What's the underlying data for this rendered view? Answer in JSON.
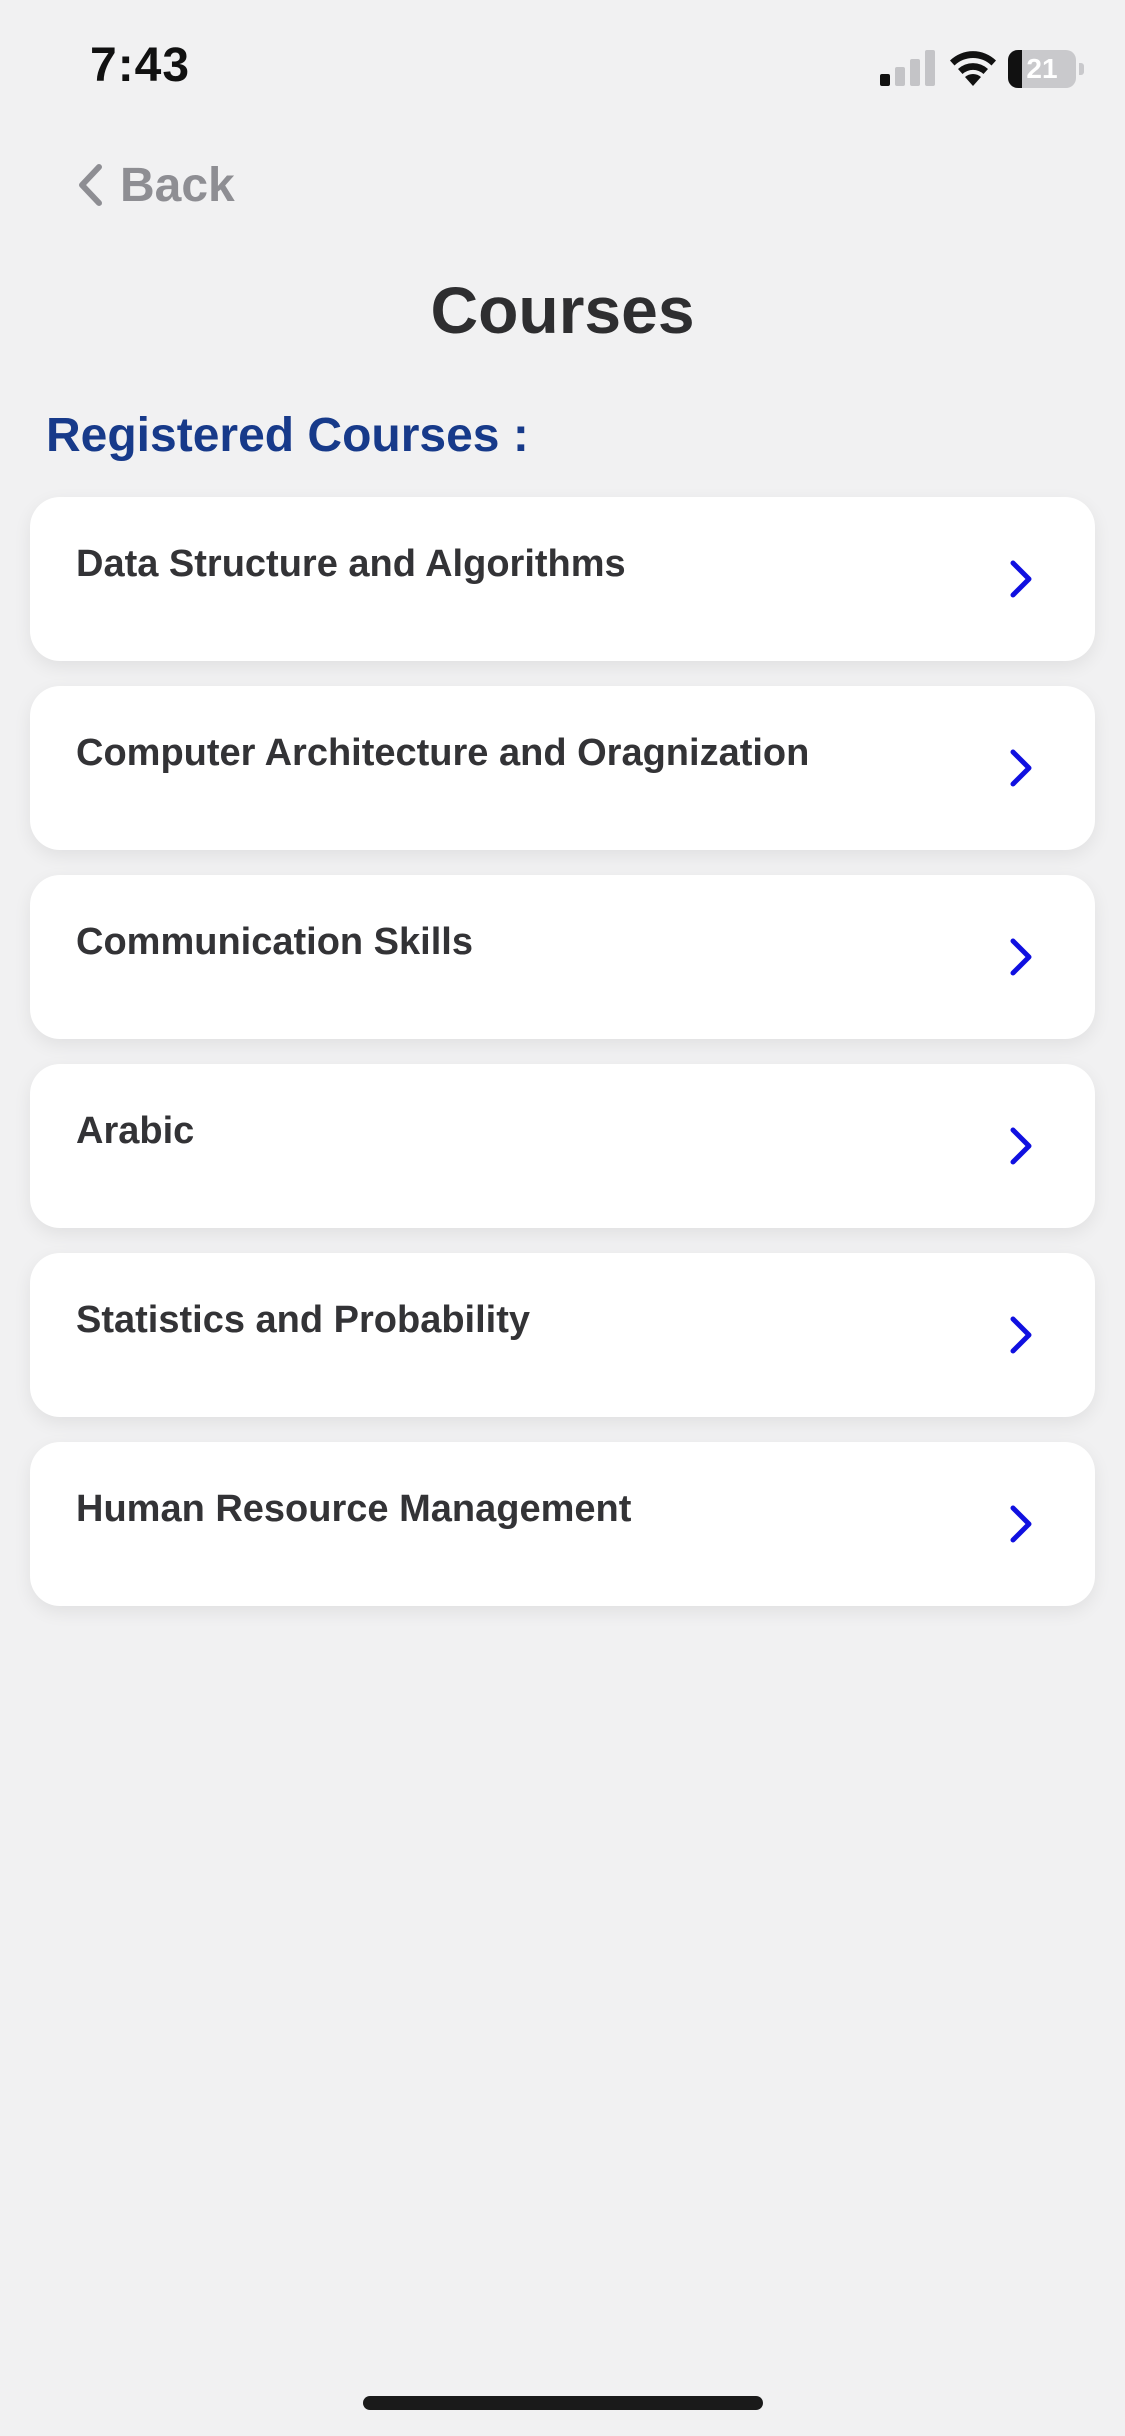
{
  "status_bar": {
    "time": "7:43",
    "battery_level": "21",
    "battery_fraction": 0.21,
    "signal_bars_active": 1,
    "signal_bars_total": 4
  },
  "nav": {
    "back_label": "Back"
  },
  "page": {
    "title": "Courses",
    "section_heading": "Registered Courses :"
  },
  "courses": [
    {
      "name": "Data Structure and Algorithms"
    },
    {
      "name": "Computer Architecture and Oragnization"
    },
    {
      "name": "Communication Skills"
    },
    {
      "name": "Arabic"
    },
    {
      "name": "Statistics and Probability"
    },
    {
      "name": "Human Resource Management"
    }
  ],
  "icons": {
    "back": "chevron-left-icon",
    "course_item": "chevron-right-icon",
    "signal": "cellular-signal-icon",
    "wifi": "wifi-icon",
    "battery": "battery-icon"
  },
  "colors": {
    "background": "#f1f1f2",
    "card": "#ffffff",
    "title_text": "#2e2e30",
    "section_heading": "#173a8a",
    "chevron_accent": "#1010e0",
    "back_text": "#8e8e93"
  }
}
